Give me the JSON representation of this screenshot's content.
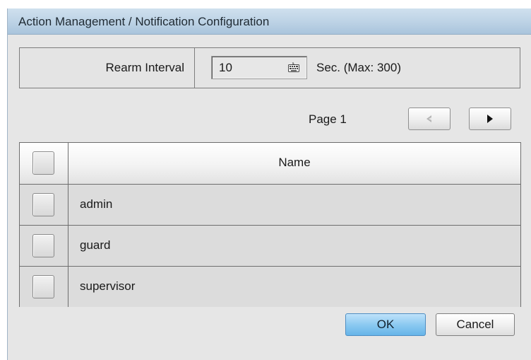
{
  "window": {
    "title": "Action Management / Notification Configuration"
  },
  "rearm": {
    "label": "Rearm Interval",
    "value": "10",
    "unit": "Sec. (Max: 300)",
    "icon": "keyboard-icon"
  },
  "pagination": {
    "page_label": "Page 1",
    "prev_icon": "arrow-left-icon",
    "next_icon": "arrow-right-icon",
    "prev_enabled": false,
    "next_enabled": true
  },
  "table": {
    "header": {
      "name": "Name",
      "checked": false
    },
    "rows": [
      {
        "name": "admin",
        "checked": false
      },
      {
        "name": "guard",
        "checked": false
      },
      {
        "name": "supervisor",
        "checked": false
      }
    ]
  },
  "buttons": {
    "ok": "OK",
    "cancel": "Cancel"
  },
  "colors": {
    "title_bar": "#bcd2e5",
    "ok_button": "#8ccaf1",
    "dialog_bg": "#e6e6e6"
  }
}
